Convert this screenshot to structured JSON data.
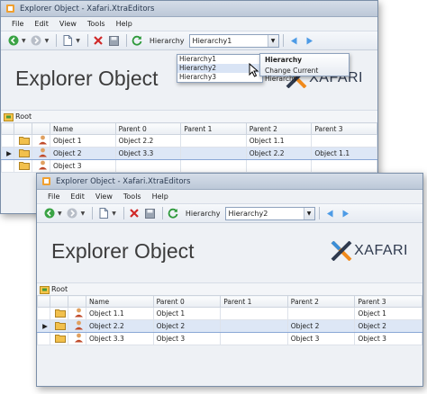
{
  "window1": {
    "title": "Explorer Object - Xafari.XtraEditors",
    "menu": [
      "File",
      "Edit",
      "View",
      "Tools",
      "Help"
    ],
    "hierarchy_label": "Hierarchy",
    "hierarchy_value": "Hierarchy1",
    "banner_title": "Explorer Object",
    "brand": "XAFARI",
    "breadcrumb": "Root",
    "columns": [
      "Name",
      "Parent 0",
      "Parent 1",
      "Parent 2",
      "Parent 3"
    ],
    "rows": [
      {
        "cells": [
          "Object 1",
          "Object 2.2",
          "",
          "Object 1.1",
          ""
        ],
        "selected": false
      },
      {
        "cells": [
          "Object 2",
          "Object 3.3",
          "",
          "Object 2.2",
          "Object 1.1"
        ],
        "selected": true
      },
      {
        "cells": [
          "Object 3",
          "",
          "",
          "",
          ""
        ],
        "selected": false
      }
    ],
    "dropdown_options": [
      "Hierarchy1",
      "Hierarchy2",
      "Hierarchy3"
    ],
    "dropdown_highlight": 1,
    "tooltip_title": "Hierarchy",
    "tooltip_body": "Change Current Hierarchy"
  },
  "window2": {
    "title": "Explorer Object - Xafari.XtraEditors",
    "menu": [
      "File",
      "Edit",
      "View",
      "Tools",
      "Help"
    ],
    "hierarchy_label": "Hierarchy",
    "hierarchy_value": "Hierarchy2",
    "banner_title": "Explorer Object",
    "brand": "XAFARI",
    "breadcrumb": "Root",
    "columns": [
      "Name",
      "Parent 0",
      "Parent 1",
      "Parent 2",
      "Parent 3"
    ],
    "rows": [
      {
        "cells": [
          "Object 1.1",
          "Object 1",
          "",
          "",
          "Object 1"
        ],
        "selected": false
      },
      {
        "cells": [
          "Object 2.2",
          "Object 2",
          "",
          "Object 2",
          "Object 2"
        ],
        "selected": true
      },
      {
        "cells": [
          "Object 3.3",
          "Object 3",
          "",
          "Object 3",
          "Object 3"
        ],
        "selected": false
      }
    ]
  },
  "colors": {
    "accent": "#3a8ed8",
    "brand_orange": "#f08a1c",
    "brand_dark": "#2f3a4e",
    "selection": "#dde7f6"
  }
}
